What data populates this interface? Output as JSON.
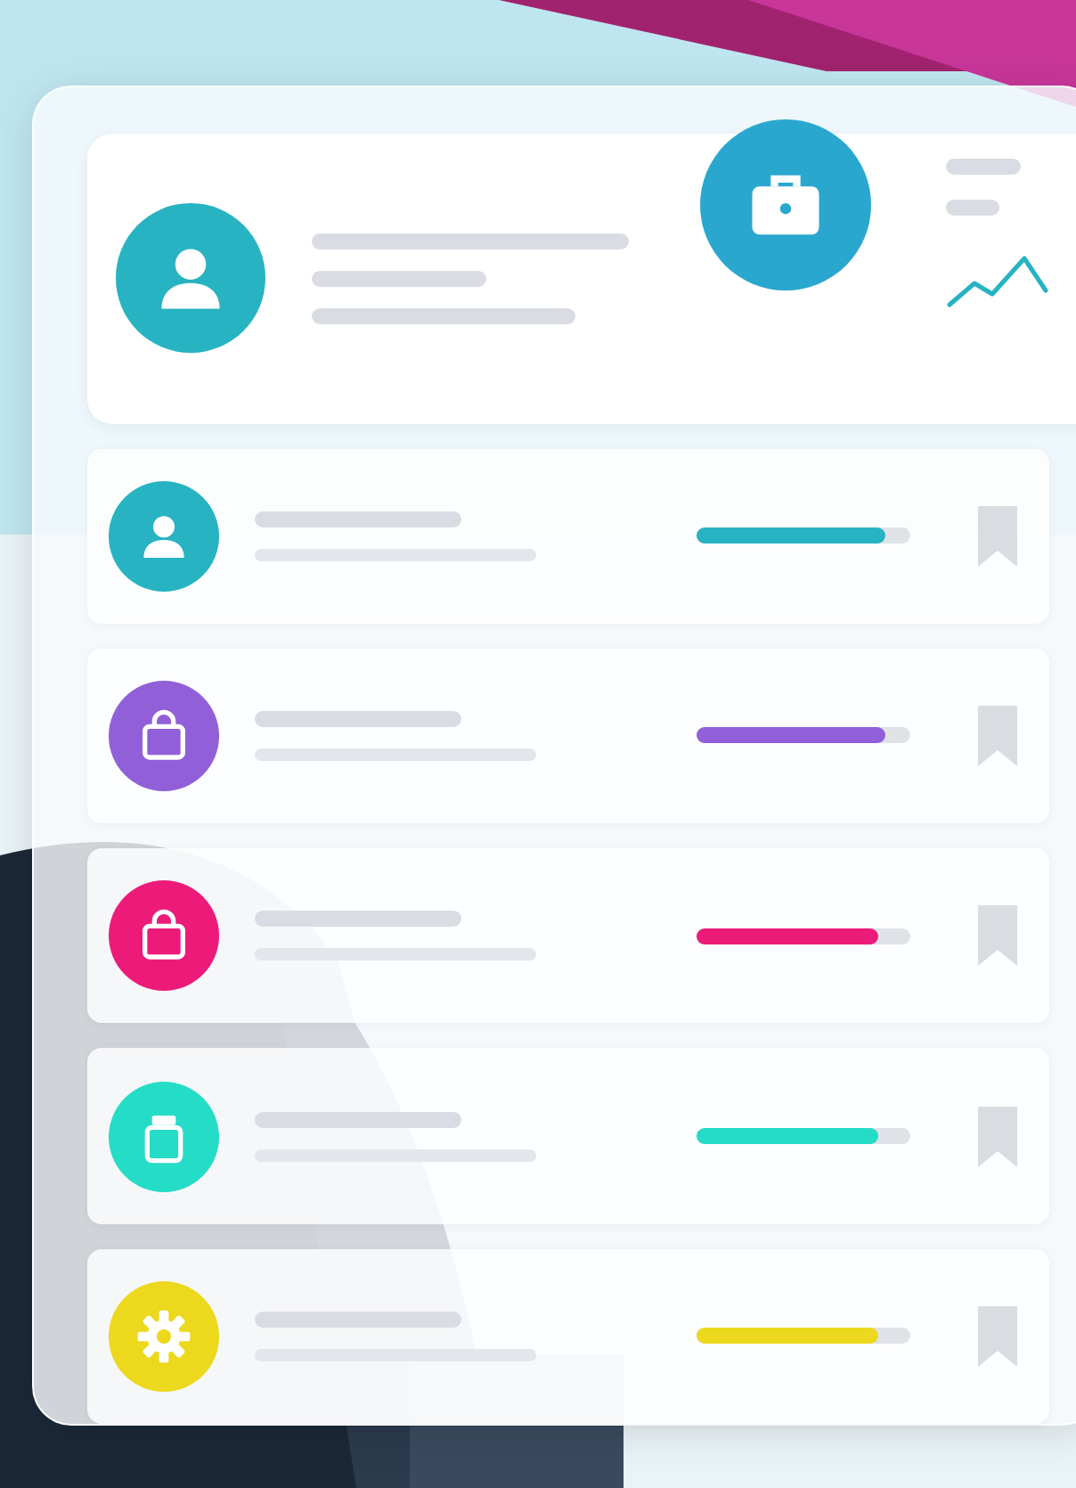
{
  "rows": [
    {
      "kind": "person",
      "color": "#27b3c2",
      "level": 0.88
    },
    {
      "kind": "bag",
      "color": "#9160d8",
      "level": 0.88
    },
    {
      "kind": "bag",
      "color": "#ec1b7a",
      "level": 0.85
    },
    {
      "kind": "jar",
      "color": "#25dcc6",
      "level": 0.85
    },
    {
      "kind": "gear",
      "color": "#ecd81c",
      "level": 0.85
    }
  ]
}
